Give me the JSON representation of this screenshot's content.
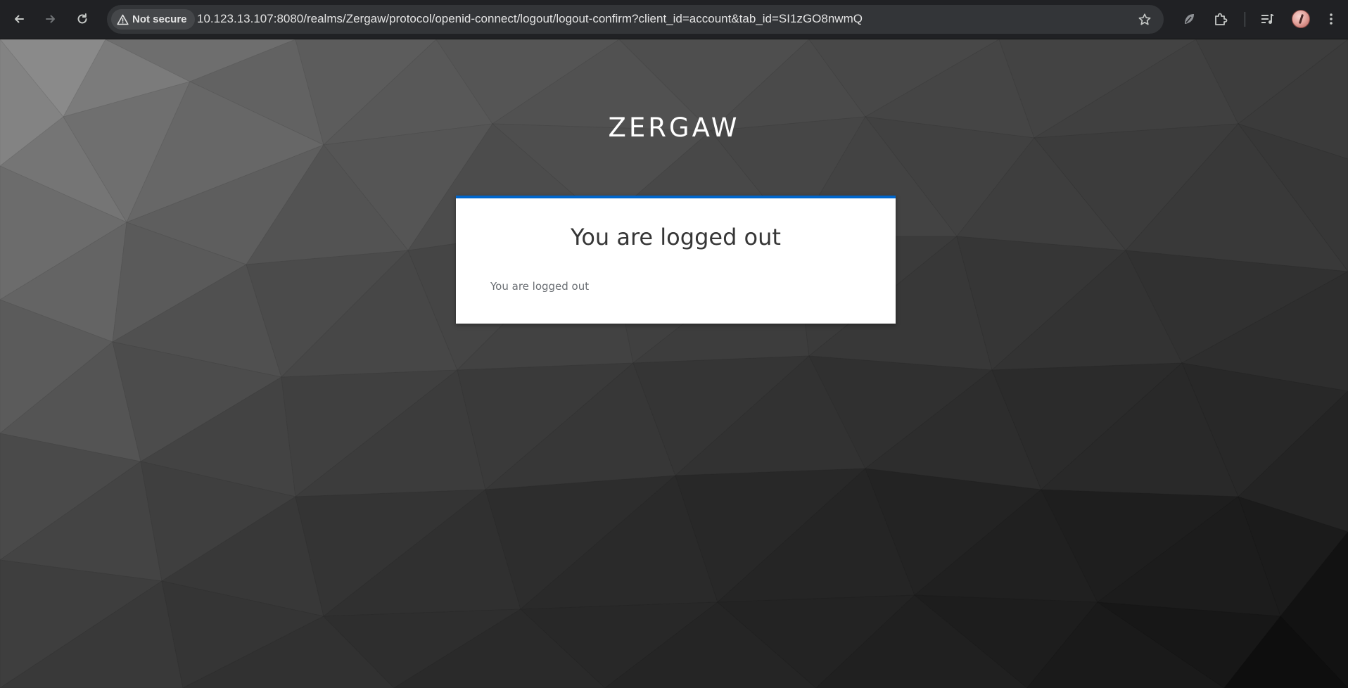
{
  "browser": {
    "security_label": "Not secure",
    "url": "10.123.13.107:8080/realms/Zergaw/protocol/openid-connect/logout/logout-confirm?client_id=account&tab_id=SI1zGO8nwmQ",
    "icons": [
      "back-arrow-icon",
      "forward-arrow-icon",
      "reload-icon",
      "warning-triangle-icon",
      "star-icon",
      "extension-leaf-icon",
      "puzzle-piece-icon",
      "media-queue-icon",
      "profile-avatar",
      "kebab-menu-icon"
    ]
  },
  "page": {
    "realm_name": "ZERGAW",
    "title": "You are logged out",
    "message": "You are logged out"
  },
  "colors": {
    "accent": "#0066cc",
    "toolbar_bg": "#202124",
    "omnibox_bg": "#333538",
    "card_bg": "#ffffff"
  }
}
